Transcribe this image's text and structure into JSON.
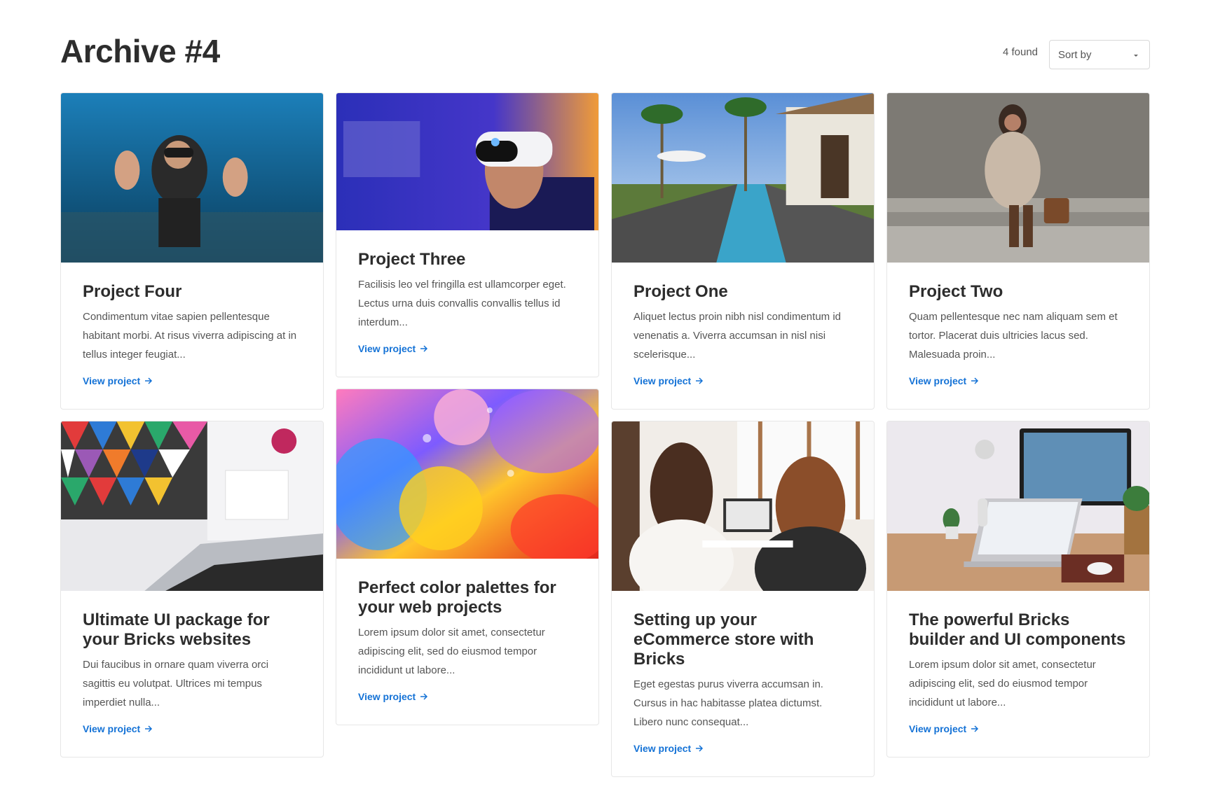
{
  "header": {
    "title": "Archive #4",
    "found": "4 found",
    "sort_label": "Sort by"
  },
  "link_label": "View project",
  "colors": {
    "link": "#1472d6",
    "title": "#2d2d2d",
    "border": "#e6e6e6"
  },
  "cards": [
    {
      "title": "Project Four",
      "excerpt": "Condimentum vitae sapien pellentesque habitant morbi. At risus viverra adipiscing at in tellus integer feugiat...",
      "image": "scuba-diver-underwater"
    },
    {
      "title": "Project Three",
      "excerpt": "Facilisis leo vel fringilla est ullamcorper eget. Lectus urna duis convallis convallis tellus id interdum...",
      "image": "person-wearing-vr-headset"
    },
    {
      "title": "Project One",
      "excerpt": "Aliquet lectus proin nibh nisl condimentum id venenatis a. Viverra accumsan in nisl nisi scelerisque...",
      "image": "resort-pool-with-palms"
    },
    {
      "title": "Project Two",
      "excerpt": "Quam pellentesque nec nam aliquam sem et tortor. Placerat duis ultricies lacus sed. Malesuada proin...",
      "image": "woman-sitting-on-steps"
    },
    {
      "title": "Ultimate UI package for your Bricks websites",
      "excerpt": "Dui faucibus in ornare quam viverra orci sagittis eu volutpat. Ultrices mi tempus imperdiet nulla...",
      "image": "laptop-with-colorful-wall"
    },
    {
      "title": "Perfect color palettes for your web projects",
      "excerpt": "Lorem ipsum dolor sit amet, consectetur adipiscing elit, sed do eiusmod tempor incididunt ut labore...",
      "image": "colorful-oil-bubbles"
    },
    {
      "title": "Setting up your eCommerce store with Bricks",
      "excerpt": "Eget egestas purus viverra accumsan in. Cursus in hac habitasse platea dictumst. Libero nunc consequat...",
      "image": "two-women-at-laptop"
    },
    {
      "title": "The powerful Bricks builder and UI components",
      "excerpt": "Lorem ipsum dolor sit amet, consectetur adipiscing elit, sed do eiusmod tempor incididunt ut labore...",
      "image": "desk-with-laptop-and-monitor"
    }
  ]
}
